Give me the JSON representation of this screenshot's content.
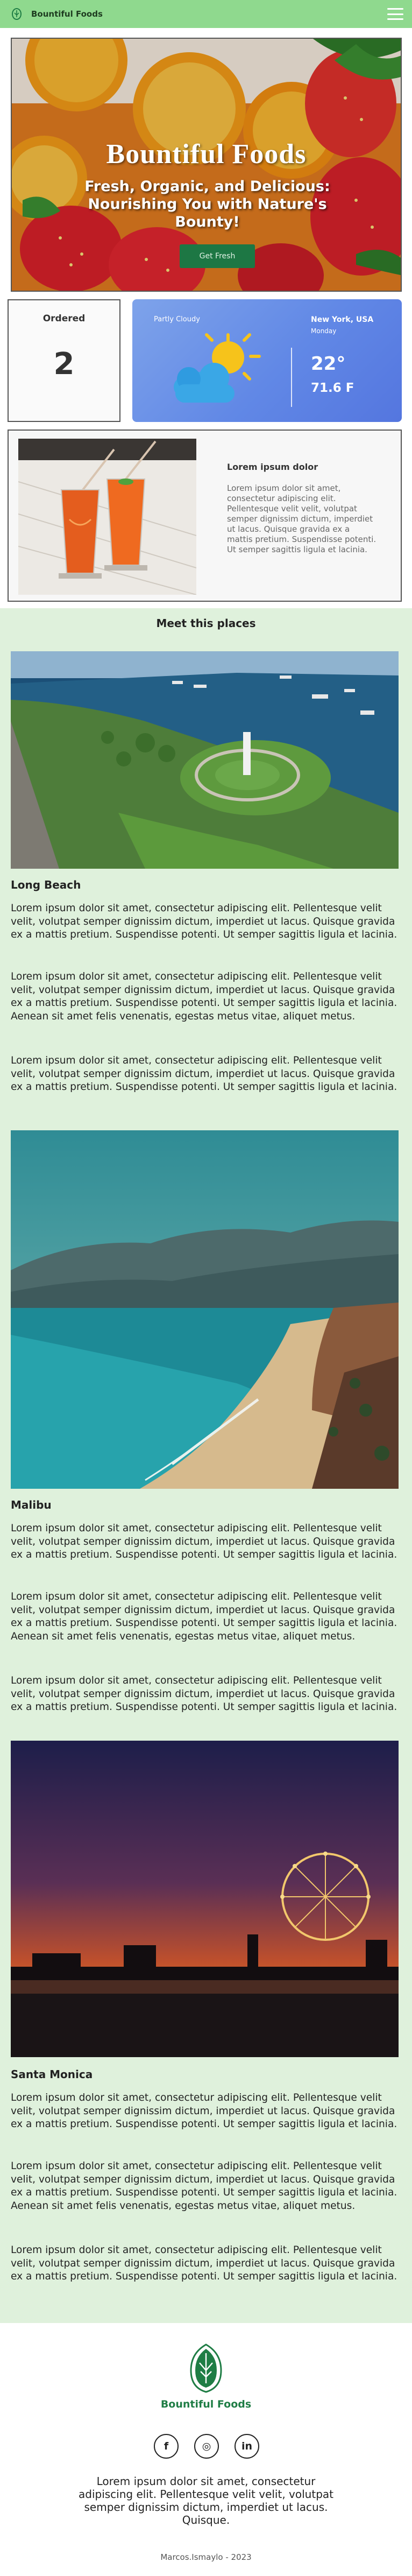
{
  "nav": {
    "brand": "Bountiful Foods"
  },
  "hero": {
    "title": "Bountiful Foods",
    "subtitle": "Fresh, Organic, and Delicious: Nourishing You with Nature's Bounty!",
    "button": "Get Fresh"
  },
  "ordered": {
    "label": "Ordered",
    "count": "2"
  },
  "weather": {
    "condition": "Partly Cloudy",
    "location": "New York, USA",
    "day": "Monday",
    "temp_c": "22°",
    "temp_f": "71.6 F",
    "icon": "partly-cloudy-icon"
  },
  "product": {
    "title": "Lorem ipsum dolor",
    "description": "Lorem ipsum dolor sit amet, consectetur adipiscing elit. Pellentesque velit velit, volutpat semper dignissim dictum, imperdiet ut lacus. Quisque gravida ex a mattis pretium. Suspendisse potenti. Ut semper sagittis ligula et lacinia."
  },
  "places": {
    "title": "Meet this places",
    "items": [
      {
        "name": "Long Beach",
        "paragraphs": [
          "Lorem ipsum dolor sit amet, consectetur adipiscing elit. Pellentesque velit velit, volutpat semper dignissim dictum, imperdiet ut lacus. Quisque gravida ex a mattis pretium. Suspendisse potenti. Ut semper sagittis ligula et lacinia.",
          "Lorem ipsum dolor sit amet, consectetur adipiscing elit. Pellentesque velit velit, volutpat semper dignissim dictum, imperdiet ut lacus. Quisque gravida ex a mattis pretium. Suspendisse potenti. Ut semper sagittis ligula et lacinia. Aenean sit amet felis venenatis, egestas metus vitae, aliquet metus.",
          "Lorem ipsum dolor sit amet, consectetur adipiscing elit. Pellentesque velit velit, volutpat semper dignissim dictum, imperdiet ut lacus. Quisque gravida ex a mattis pretium. Suspendisse potenti. Ut semper sagittis ligula et lacinia."
        ]
      },
      {
        "name": "Malibu",
        "paragraphs": [
          "Lorem ipsum dolor sit amet, consectetur adipiscing elit. Pellentesque velit velit, volutpat semper dignissim dictum, imperdiet ut lacus. Quisque gravida ex a mattis pretium. Suspendisse potenti. Ut semper sagittis ligula et lacinia.",
          "Lorem ipsum dolor sit amet, consectetur adipiscing elit. Pellentesque velit velit, volutpat semper dignissim dictum, imperdiet ut lacus. Quisque gravida ex a mattis pretium. Suspendisse potenti. Ut semper sagittis ligula et lacinia. Aenean sit amet felis venenatis, egestas metus vitae, aliquet metus.",
          "Lorem ipsum dolor sit amet, consectetur adipiscing elit. Pellentesque velit velit, volutpat semper dignissim dictum, imperdiet ut lacus. Quisque gravida ex a mattis pretium. Suspendisse potenti. Ut semper sagittis ligula et lacinia."
        ]
      },
      {
        "name": "Santa Monica",
        "paragraphs": [
          "Lorem ipsum dolor sit amet, consectetur adipiscing elit. Pellentesque velit velit, volutpat semper dignissim dictum, imperdiet ut lacus. Quisque gravida ex a mattis pretium. Suspendisse potenti. Ut semper sagittis ligula et lacinia.",
          "Lorem ipsum dolor sit amet, consectetur adipiscing elit. Pellentesque velit velit, volutpat semper dignissim dictum, imperdiet ut lacus. Quisque gravida ex a mattis pretium. Suspendisse potenti. Ut semper sagittis ligula et lacinia. Aenean sit amet felis venenatis, egestas metus vitae, aliquet metus.",
          "Lorem ipsum dolor sit amet, consectetur adipiscing elit. Pellentesque velit velit, volutpat semper dignissim dictum, imperdiet ut lacus. Quisque gravida ex a mattis pretium. Suspendisse potenti. Ut semper sagittis ligula et lacinia."
        ]
      }
    ]
  },
  "footer": {
    "brand": "Bountiful Foods",
    "socials": [
      {
        "icon": "facebook-icon",
        "glyph": "f"
      },
      {
        "icon": "instagram-icon",
        "glyph": "◎"
      },
      {
        "icon": "linkedin-icon",
        "glyph": "in"
      }
    ],
    "text": "Lorem ipsum dolor sit amet, consectetur adipiscing elit. Pellentesque velit velit, volutpat semper dignissim dictum, imperdiet ut lacus. Quisque.",
    "copyright": "Marcos.Ismaylo - 2023"
  },
  "colors": {
    "nav_bg": "#8fd98e",
    "brand_green": "#1f7d45",
    "button_green": "#1d7744",
    "places_bg": "#dff1dc",
    "weather_blue": "#6188e6"
  }
}
